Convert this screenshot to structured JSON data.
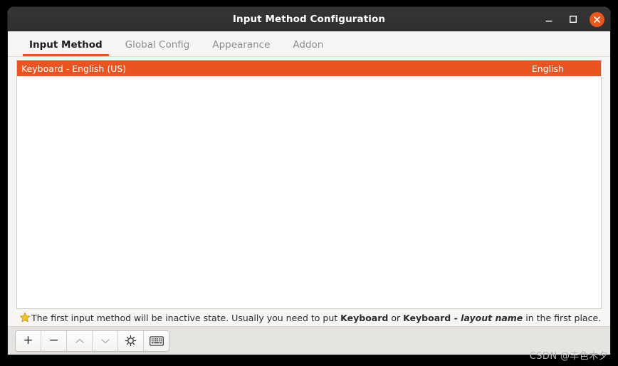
{
  "window": {
    "title": "Input Method Configuration",
    "controls": {
      "minimize_label": "Minimize",
      "maximize_label": "Maximize",
      "close_label": "Close"
    }
  },
  "tabs": [
    {
      "label": "Input Method",
      "active": true
    },
    {
      "label": "Global Config",
      "active": false
    },
    {
      "label": "Appearance",
      "active": false
    },
    {
      "label": "Addon",
      "active": false
    }
  ],
  "list": {
    "rows": [
      {
        "name": "Keyboard - English (US)",
        "language": "English",
        "selected": true
      }
    ]
  },
  "hint": {
    "icon": "star-icon",
    "part1": "The first input method will be inactive state. Usually you need to put ",
    "bold1": "Keyboard",
    "part2": " or ",
    "bold2": "Keyboard - ",
    "italic": "layout name",
    "part3": " in the first place."
  },
  "toolbar": {
    "buttons": [
      {
        "name": "add-button",
        "icon": "plus-icon",
        "glyph": "+",
        "disabled": false
      },
      {
        "name": "remove-button",
        "icon": "minus-icon",
        "glyph": "−",
        "disabled": false
      },
      {
        "name": "move-up-button",
        "icon": "chevron-up-icon",
        "glyph": "",
        "disabled": true
      },
      {
        "name": "move-down-button",
        "icon": "chevron-down-icon",
        "glyph": "",
        "disabled": true
      },
      {
        "name": "configure-button",
        "icon": "gear-icon",
        "glyph": "",
        "disabled": false
      },
      {
        "name": "keyboard-layout-button",
        "icon": "keyboard-icon",
        "glyph": "",
        "disabled": false
      }
    ]
  },
  "watermark": {
    "text": "CSDN @丰色木夕"
  },
  "colors": {
    "accent": "#e95420",
    "titlebar": "#303030",
    "window_bg": "#f6f5f4",
    "footer_bg": "#e6e4e1",
    "list_bg": "#ffffff",
    "star": "#f0c419"
  }
}
